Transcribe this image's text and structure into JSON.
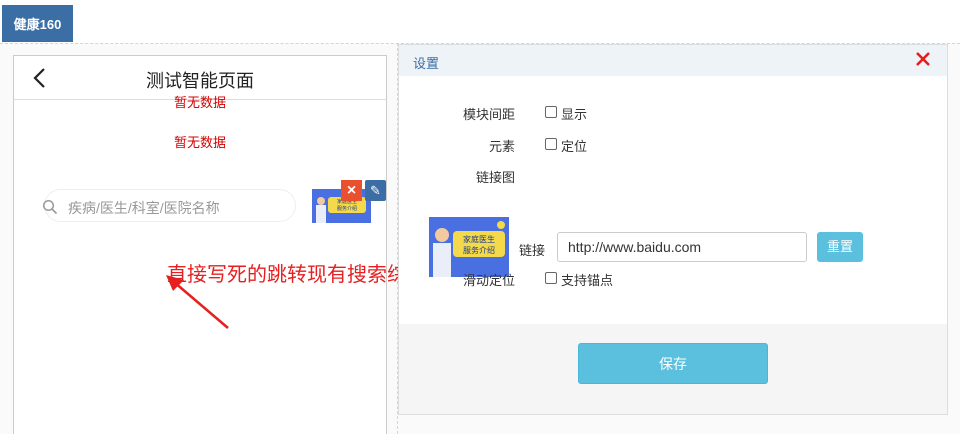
{
  "app": {
    "tab_label": "健康160"
  },
  "phone": {
    "title": "测试智能页面",
    "empty_text_1": "暂无数据",
    "empty_text_2": "暂无数据",
    "search_placeholder": "疾病/医生/科室/医院名称",
    "delete_icon": "×",
    "edit_icon": "✎",
    "thumb_text": "家庭医生 服务介绍"
  },
  "annotation": {
    "text": "直接写死的跳转现有搜索综合页"
  },
  "settings": {
    "title": "设置",
    "module_spacing": {
      "label": "模块间距",
      "option": "显示",
      "checked": false
    },
    "element": {
      "label": "元素",
      "option": "定位",
      "checked": false
    },
    "link_image": {
      "label": "链接图",
      "image_text": "家庭医生 服务介绍"
    },
    "link": {
      "label": "链接",
      "value": "http://www.baidu.com",
      "reset_label": "重置"
    },
    "scroll_position": {
      "label": "滑动定位",
      "option": "支持锚点",
      "checked": false
    },
    "save_label": "保存"
  },
  "colors": {
    "brand": "#3a6ea5",
    "accent": "#5bc0de",
    "error": "#d40000",
    "annotation": "#e62020"
  }
}
